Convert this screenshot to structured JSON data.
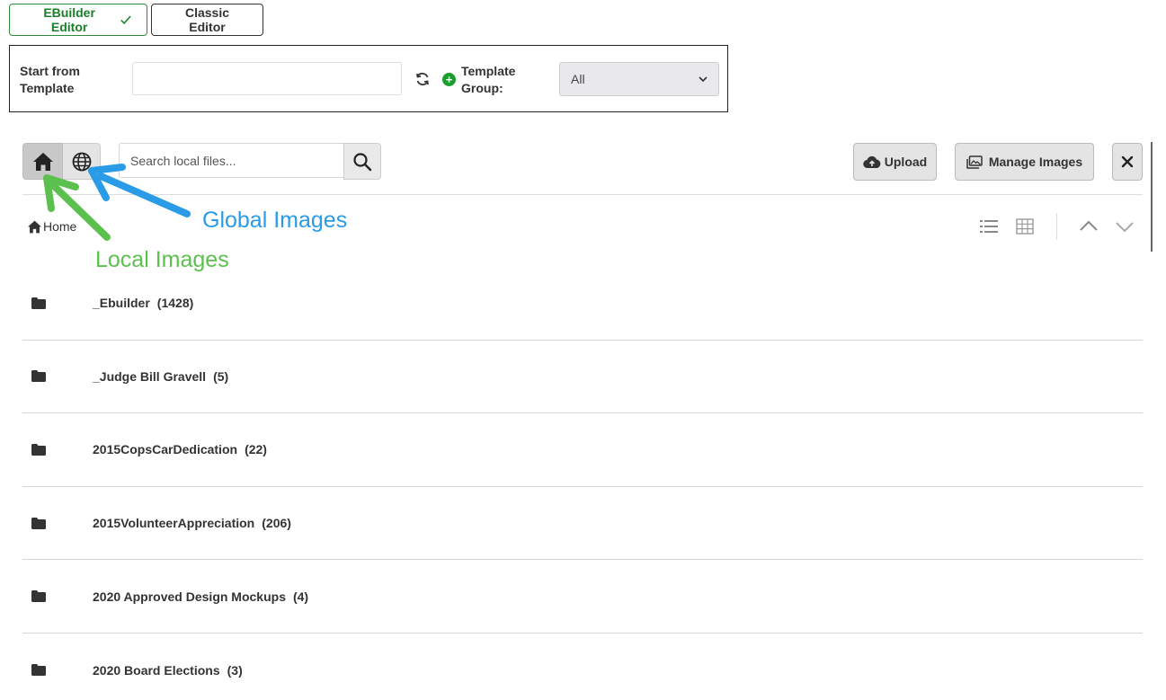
{
  "editor_tabs": {
    "ebuilder_label": "EBuilder Editor",
    "classic_label": "Classic Editor"
  },
  "template": {
    "start_label": "Start from Template",
    "input_value": "",
    "group_label": "Template Group:",
    "group_selected": "All"
  },
  "toolbar": {
    "search_placeholder": "Search local files...",
    "upload_label": "Upload",
    "manage_label": "Manage Images"
  },
  "breadcrumb": {
    "home_label": "Home"
  },
  "annotations": {
    "global_label": "Global Images",
    "local_label": "Local Images",
    "global_color": "#2a9be6",
    "local_color": "#5cc04e"
  },
  "folders": [
    {
      "name": "_Ebuilder",
      "count": "(1428)"
    },
    {
      "name": "_Judge Bill Gravell",
      "count": "(5)"
    },
    {
      "name": "2015CopsCarDedication",
      "count": "(22)"
    },
    {
      "name": "2015VolunteerAppreciation",
      "count": "(206)"
    },
    {
      "name": "2020 Approved Design Mockups",
      "count": "(4)"
    },
    {
      "name": "2020 Board Elections",
      "count": "(3)"
    }
  ],
  "colors": {
    "accent_green": "#1a7f2a",
    "plus_green": "#1a9e2c"
  }
}
